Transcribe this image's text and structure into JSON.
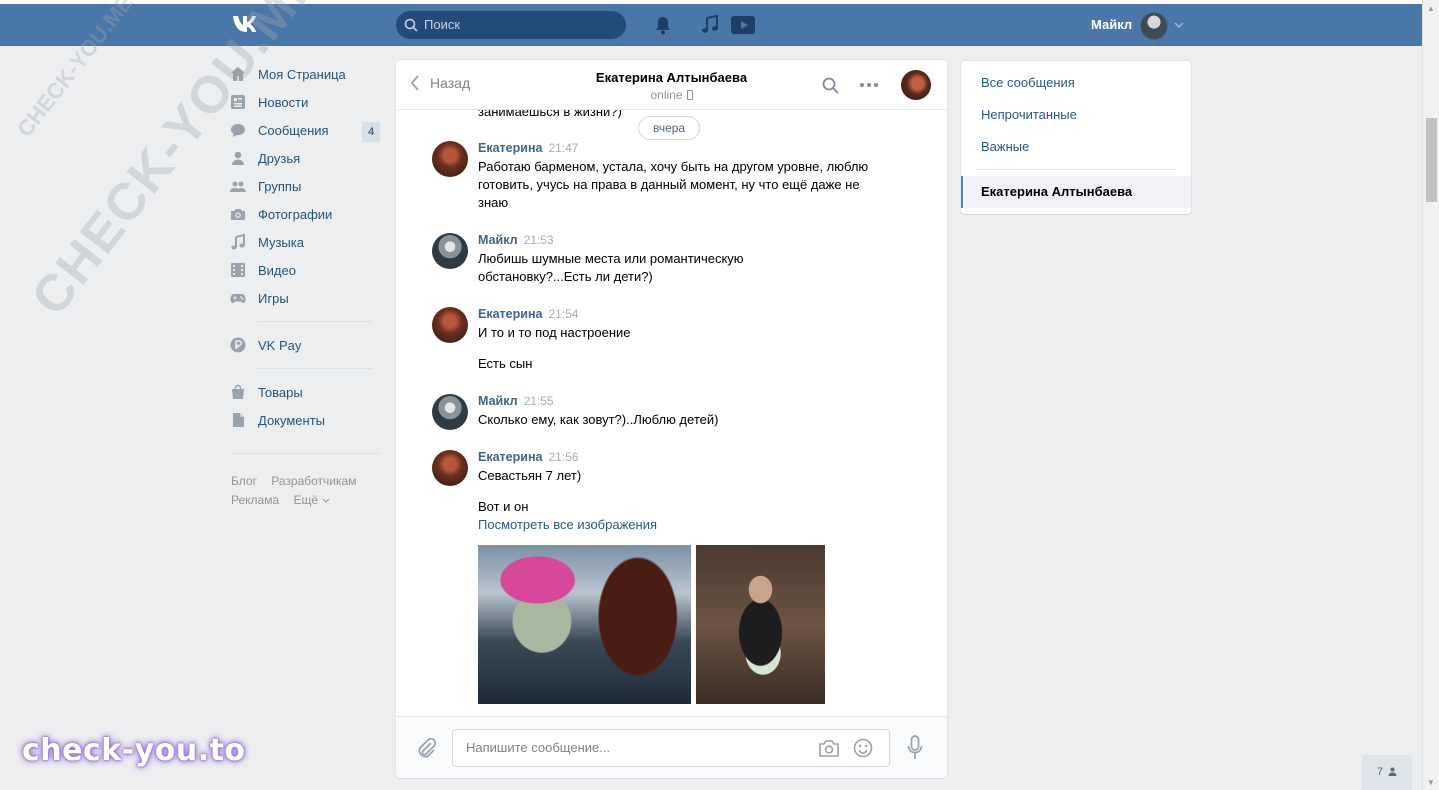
{
  "header": {
    "search_placeholder": "Поиск",
    "user_name": "Майкл"
  },
  "nav": {
    "items": [
      {
        "label": "Моя Страница",
        "icon": "home-icon"
      },
      {
        "label": "Новости",
        "icon": "news-icon"
      },
      {
        "label": "Сообщения",
        "icon": "messages-icon",
        "badge": "4"
      },
      {
        "label": "Друзья",
        "icon": "friends-icon"
      },
      {
        "label": "Группы",
        "icon": "groups-icon"
      },
      {
        "label": "Фотографии",
        "icon": "camera-icon"
      },
      {
        "label": "Музыка",
        "icon": "music-icon"
      },
      {
        "label": "Видео",
        "icon": "video-icon"
      },
      {
        "label": "Игры",
        "icon": "games-icon"
      },
      {
        "label": "VK Pay",
        "icon": "vkpay-icon"
      },
      {
        "label": "Товары",
        "icon": "bag-icon"
      },
      {
        "label": "Документы",
        "icon": "document-icon"
      }
    ],
    "footer": {
      "blog": "Блог",
      "dev": "Разработчикам",
      "ads": "Реклама",
      "more": "Ещё"
    }
  },
  "chat": {
    "back_label": "Назад",
    "title": "Екатерина Алтынбаева",
    "status": "online",
    "cut_text": "занимаешься в жизни?)",
    "day_label": "вчера",
    "messages": [
      {
        "author": "Екатерина",
        "time": "21:47",
        "text": "Работаю барменом, устала, хочу быть на другом уровне, люблю готовить, учусь на права в данный момент, ну что ещё даже не знаю"
      },
      {
        "author": "Майкл",
        "time": "21:53",
        "text": "Любишь шумные места или романтическую обстановку?...Есть ли дети?)"
      },
      {
        "author": "Екатерина",
        "time": "21:54",
        "text": "И то и то под настроение",
        "text2": "Есть сын"
      },
      {
        "author": "Майкл",
        "time": "21:55",
        "text": "Сколько ему, как зовут?)..Люблю детей)"
      },
      {
        "author": "Екатерина",
        "time": "21:56",
        "text": "Севастьян 7 лет)",
        "text2": "Вот и он",
        "link": "Посмотреть все изображения"
      }
    ],
    "composer_placeholder": "Напишите сообщение..."
  },
  "right_panel": {
    "all": "Все сообщения",
    "unread": "Непрочитанные",
    "important": "Важные",
    "active_chat": "Екатерина Алтынбаева"
  },
  "watermark": {
    "big": "CHECK-YOU.ME",
    "small": "CHECK-YOU.ME",
    "brand": "check-you.to"
  },
  "counter": "7",
  "colors": {
    "header": "#4a76a8",
    "link": "#2a5885",
    "author": "#42648b",
    "bg": "#edeef0"
  }
}
